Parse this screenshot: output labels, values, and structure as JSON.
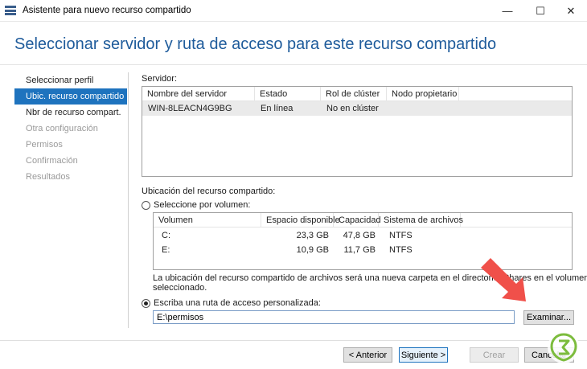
{
  "window": {
    "title": "Asistente para nuevo recurso compartido",
    "minimize_glyph": "—",
    "maximize_glyph": "☐",
    "close_glyph": "✕"
  },
  "header": {
    "title": "Seleccionar servidor y ruta de acceso para este recurso compartido"
  },
  "nav": {
    "items": [
      {
        "label": "Seleccionar perfil",
        "state": "normal"
      },
      {
        "label": "Ubic. recurso compartido",
        "state": "active"
      },
      {
        "label": "Nbr de recurso compart.",
        "state": "normal"
      },
      {
        "label": "Otra configuración",
        "state": "disabled"
      },
      {
        "label": "Permisos",
        "state": "disabled"
      },
      {
        "label": "Confirmación",
        "state": "disabled"
      },
      {
        "label": "Resultados",
        "state": "disabled"
      }
    ]
  },
  "server": {
    "label": "Servidor:",
    "columns": [
      "Nombre del servidor",
      "Estado",
      "Rol de clúster",
      "Nodo propietario"
    ],
    "rows": [
      {
        "name": "WIN-8LEACN4G9BG",
        "status": "En línea",
        "role": "No en clúster",
        "owner": ""
      }
    ]
  },
  "location": {
    "label": "Ubicación del recurso compartido:",
    "by_volume_label": "Seleccione por volumen:",
    "columns": [
      "Volumen",
      "Espacio disponible",
      "Capacidad",
      "Sistema de archivos"
    ],
    "rows": [
      {
        "volume": "C:",
        "free": "23,3 GB",
        "capacity": "47,8 GB",
        "fs": "NTFS"
      },
      {
        "volume": "E:",
        "free": "10,9 GB",
        "capacity": "11,7 GB",
        "fs": "NTFS"
      }
    ],
    "note_line1": "La ubicación del recurso compartido de archivos será una nueva carpeta en el directorio \\Shares en el volumen",
    "note_line2": "seleccionado.",
    "custom_label": "Escriba una ruta de acceso personalizada:",
    "custom_value": "E:\\permisos",
    "selected_option": "custom"
  },
  "buttons": {
    "browse": "Examinar...",
    "back": "< Anterior",
    "next": "Siguiente >",
    "create": "Crear",
    "cancel": "Cancelar"
  },
  "colors": {
    "accent": "#1e73be",
    "title_blue": "#1e5b9b",
    "arrow": "#f0504a"
  }
}
